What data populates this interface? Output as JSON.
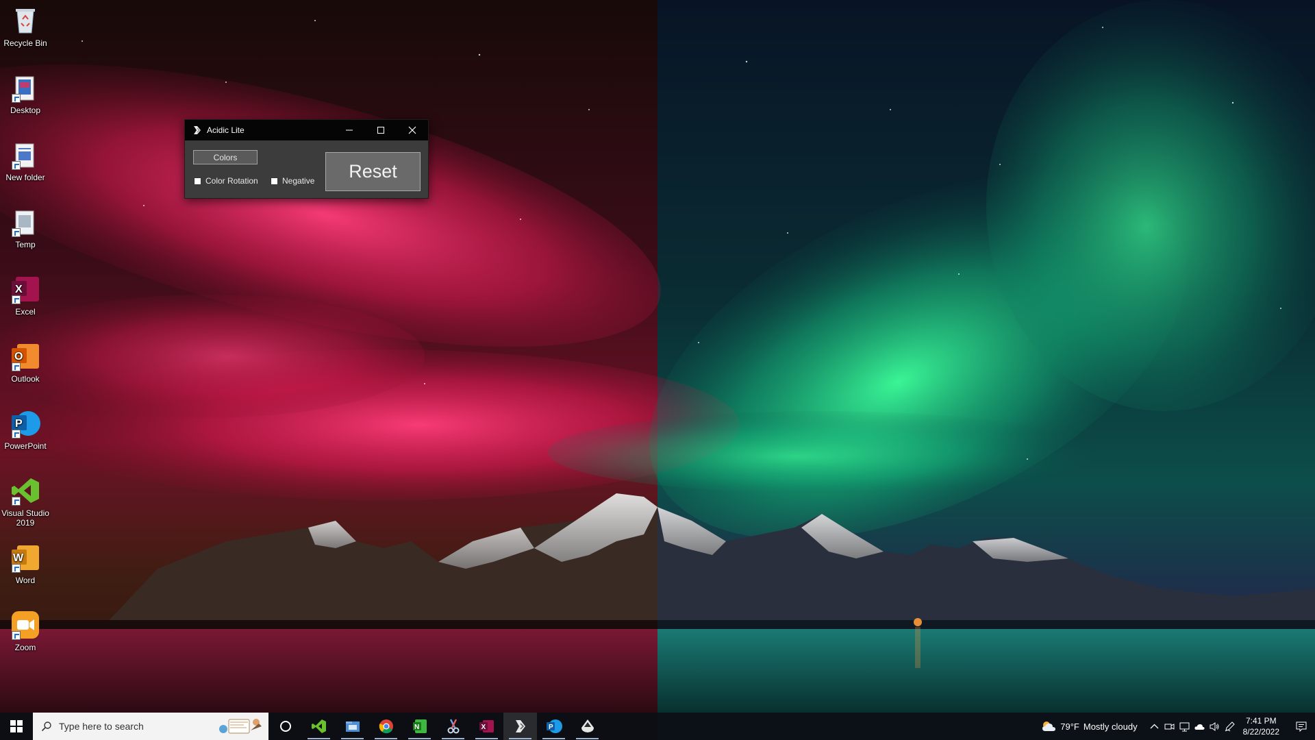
{
  "desktop": {
    "icons": [
      {
        "label": "Recycle Bin",
        "icon": "recycle-bin-icon"
      },
      {
        "label": "Desktop",
        "icon": "folder-icon"
      },
      {
        "label": "New folder",
        "icon": "folder-icon"
      },
      {
        "label": "Temp",
        "icon": "folder-icon"
      },
      {
        "label": "Excel",
        "icon": "excel-icon"
      },
      {
        "label": "Outlook",
        "icon": "outlook-icon"
      },
      {
        "label": "PowerPoint",
        "icon": "powerpoint-icon"
      },
      {
        "label": "Visual Studio\n2019",
        "icon": "visual-studio-icon"
      },
      {
        "label": "Word",
        "icon": "word-icon"
      },
      {
        "label": "Zoom",
        "icon": "zoom-icon"
      }
    ]
  },
  "window": {
    "title": "Acidic Lite",
    "colors_button": "Colors",
    "color_rotation_label": "Color Rotation",
    "negative_label": "Negative",
    "reset_button": "Reset",
    "color_rotation_checked": false,
    "negative_checked": false
  },
  "taskbar": {
    "search_placeholder": "Type here to search",
    "apps": [
      "cortana-icon",
      "visual-studio-icon",
      "file-explorer-icon",
      "chrome-icon",
      "onenote-icon",
      "snipping-tool-icon",
      "excel-icon",
      "acidic-app-icon",
      "powerpoint-icon",
      "inkscape-icon"
    ]
  },
  "tray": {
    "temperature": "79°F",
    "weather": "Mostly cloudy",
    "time": "7:41 PM",
    "date": "8/22/2022"
  },
  "colors": {
    "accent": "#0078d7",
    "left_aurora": "#e0205a",
    "right_aurora": "#23d27a"
  }
}
